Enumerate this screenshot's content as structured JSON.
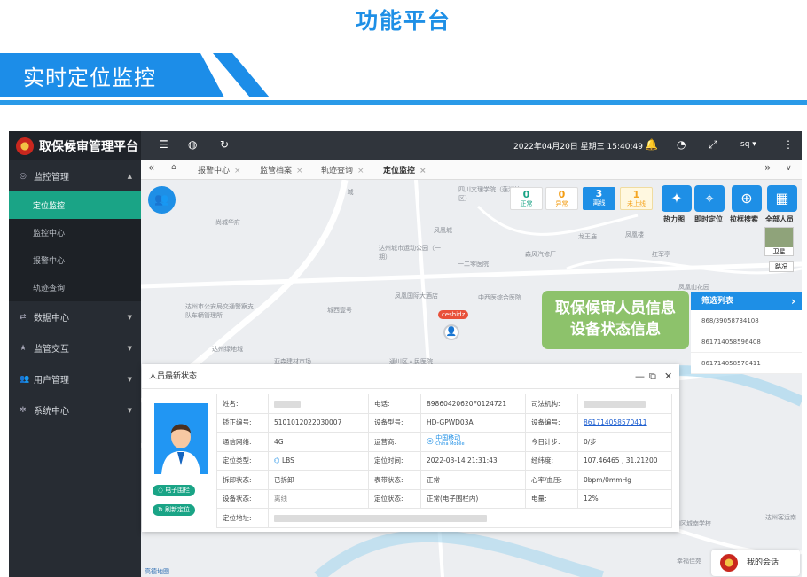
{
  "hero": {
    "title": "功能平台",
    "banner": "实时定位监控"
  },
  "app": {
    "brand": "取保候审管理平台",
    "datetime": "2022年04月20日 星期三 15:40:49",
    "user": "sq ▾",
    "menu": [
      {
        "label": "监控管理",
        "icon": "eye-icon"
      },
      {
        "label": "数据中心",
        "icon": "shuffle-icon"
      },
      {
        "label": "监管交互",
        "icon": "star-icon"
      },
      {
        "label": "用户管理",
        "icon": "users-icon"
      },
      {
        "label": "系统中心",
        "icon": "gear-icon"
      }
    ],
    "submenu": [
      "定位监控",
      "监控中心",
      "报警中心",
      "轨迹查询"
    ],
    "tabs": [
      "报警中心",
      "监管档案",
      "轨迹查询",
      "定位监控"
    ],
    "nav_back": "«",
    "nav_forward": "»",
    "nav_dropdown": "∨"
  },
  "map": {
    "places": [
      "四川文理学院（莲湖校区）",
      "尚城华府",
      "风凰城",
      "龙王庙",
      "凤凰楼",
      "达州城市运动公园（一期）",
      "一二零医院",
      "凤凰国际大酒店",
      "中西医综合医院",
      "达州市公安局交通警察支队车辆管理所",
      "城西壹号",
      "达州绿地城",
      "亚森建材市场",
      "通川区人民医院",
      "达川区城南学校",
      "幸福佳苑",
      "红军亭",
      "凤凰山花园",
      "森风汽修厂",
      "达州客运南",
      "城"
    ],
    "marker_label": "ceshidz",
    "stats": [
      {
        "count": "0",
        "label": "正常"
      },
      {
        "count": "0",
        "label": "异常"
      },
      {
        "count": "3",
        "label": "离线"
      },
      {
        "count": "1",
        "label": "未上线"
      }
    ],
    "tools": [
      {
        "label": "热力图",
        "icon": "bird-icon"
      },
      {
        "label": "即时定位",
        "icon": "pin-icon"
      },
      {
        "label": "拉框搜索",
        "icon": "zoom-box-icon"
      },
      {
        "label": "全部人员",
        "icon": "grid-icon"
      }
    ],
    "layers": {
      "satellite": "卫星",
      "road": "路况"
    },
    "filter": {
      "title": "筛选列表",
      "rows": [
        "868/39058734108",
        "861714058596408",
        "861714058570411"
      ]
    },
    "callout": [
      "取保候审人员信息",
      "设备状态信息"
    ],
    "attribution": "高德地图"
  },
  "popup": {
    "title": "人员最新状态",
    "buttons": {
      "fence": "电子围栏",
      "refresh": "刷新定位"
    },
    "labels": {
      "name": "姓名:",
      "phone": "电话:",
      "police": "司法机构:",
      "cert": "矫正编号:",
      "device_model": "设备型号:",
      "device_no": "设备编号:",
      "network": "通信网络:",
      "carrier": "运营商:",
      "steps": "今日计步:",
      "locate_type": "定位类型:",
      "locate_time": "定位时间:",
      "lnglat": "经纬度:",
      "tamper": "拆卸状态:",
      "watch": "表带状态:",
      "heart": "心率/血压:",
      "device_state": "设备状态:",
      "locate_state": "定位状态:",
      "battery": "电量:",
      "address": "定位地址:"
    },
    "values": {
      "phone": "89860420620F0124721",
      "cert": "5101012022030007",
      "device_model": "HD-GPWD03A",
      "device_no": "861714058570411",
      "network": "4G",
      "carrier": "中国移动",
      "carrier_en": "China Mobile",
      "steps": "0/步",
      "locate_type": "LBS",
      "locate_time": "2022-03-14 21:31:43",
      "lnglat": "107.46465 , 31.21200",
      "tamper": "已拆卸",
      "watch": "正常",
      "heart": "0bpm/0mmHg",
      "device_state": "离线",
      "locate_state": "正常(电子围栏内)",
      "battery": "12%"
    }
  },
  "chat": "我的会话"
}
